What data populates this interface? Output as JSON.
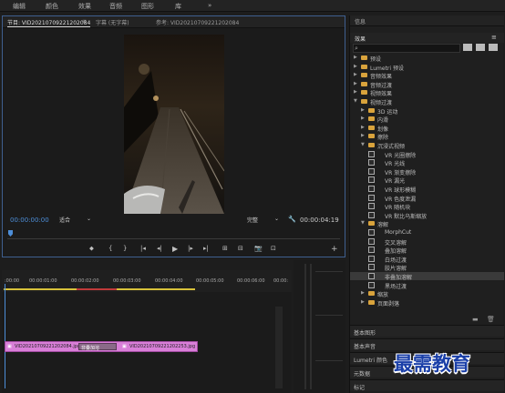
{
  "topbar": {
    "items": [
      "编辑",
      "颜色",
      "效果",
      "音频",
      "图形",
      "库"
    ],
    "more": "»"
  },
  "monitor": {
    "tab_program": "节目: VID20210709221202084",
    "tab_menu": "≡",
    "tab_caption": "字幕 (无字幕)",
    "tab_ref": "参考: VID20210709221202084",
    "timecode_left": "00:00:00:00",
    "fit": "适合",
    "quality": "完整",
    "wrench": "🔧",
    "timecode_right": "00:00:04:19"
  },
  "controls": [
    "⬥",
    "{",
    "}",
    "|◂",
    "◂|",
    "▶",
    "|▸",
    "▸|",
    "⊞",
    "⊟",
    "📷",
    "⊡",
    "+"
  ],
  "effects": {
    "tab1": "信息",
    "tab2": "效果",
    "search_icon": "⌕",
    "tree": [
      {
        "label": "预设",
        "level": 0,
        "kind": "folder"
      },
      {
        "label": "Lumetri 预设",
        "level": 0,
        "kind": "folder"
      },
      {
        "label": "音频效果",
        "level": 0,
        "kind": "folder"
      },
      {
        "label": "音频过渡",
        "level": 0,
        "kind": "folder"
      },
      {
        "label": "视频效果",
        "level": 0,
        "kind": "folder"
      },
      {
        "label": "视频过渡",
        "level": 0,
        "kind": "folder",
        "open": true
      },
      {
        "label": "3D 运动",
        "level": 1,
        "kind": "folder"
      },
      {
        "label": "内滑",
        "level": 1,
        "kind": "folder"
      },
      {
        "label": "划像",
        "level": 1,
        "kind": "folder"
      },
      {
        "label": "擦除",
        "level": 1,
        "kind": "folder"
      },
      {
        "label": "沉浸式视频",
        "level": 1,
        "kind": "folder",
        "open": true
      },
      {
        "label": "VR 光圈擦除",
        "level": 2,
        "kind": "fx"
      },
      {
        "label": "VR 光线",
        "level": 2,
        "kind": "fx"
      },
      {
        "label": "VR 渐变擦除",
        "level": 2,
        "kind": "fx"
      },
      {
        "label": "VR 漏光",
        "level": 2,
        "kind": "fx"
      },
      {
        "label": "VR 球形模糊",
        "level": 2,
        "kind": "fx"
      },
      {
        "label": "VR 色度泄漏",
        "level": 2,
        "kind": "fx"
      },
      {
        "label": "VR 随机块",
        "level": 2,
        "kind": "fx"
      },
      {
        "label": "VR 默比乌斯缩放",
        "level": 2,
        "kind": "fx"
      },
      {
        "label": "溶解",
        "level": 1,
        "kind": "folder",
        "open": true
      },
      {
        "label": "MorphCut",
        "level": 2,
        "kind": "fx"
      },
      {
        "label": "交叉溶解",
        "level": 2,
        "kind": "fx"
      },
      {
        "label": "叠加溶解",
        "level": 2,
        "kind": "fx"
      },
      {
        "label": "白场过渡",
        "level": 2,
        "kind": "fx"
      },
      {
        "label": "胶片溶解",
        "level": 2,
        "kind": "fx"
      },
      {
        "label": "非叠加溶解",
        "level": 2,
        "kind": "fx",
        "selected": true
      },
      {
        "label": "黑场过渡",
        "level": 2,
        "kind": "fx"
      },
      {
        "label": "缩放",
        "level": 1,
        "kind": "folder"
      },
      {
        "label": "页面剥落",
        "level": 1,
        "kind": "folder"
      }
    ],
    "panels": [
      "基本图形",
      "基本声音",
      "Lumetri 颜色",
      "元数据",
      "标记"
    ]
  },
  "timeline": {
    "ticks": [
      ":00:00",
      "00:00:01:00",
      "00:00:02:00",
      "00:00:03:00",
      "00:00:04:00",
      "00:00:05:00",
      "00:00:06:00",
      "00:00:"
    ],
    "clip1": "VID20210709221202084.jpg",
    "transition": "非叠加溶",
    "clip2": "VID20210709221202253.jpg"
  },
  "watermark": "最需教育",
  "colors": {
    "accent": "#4d8ed8",
    "clip": "#d97fd8",
    "folder": "#d9a33c"
  }
}
